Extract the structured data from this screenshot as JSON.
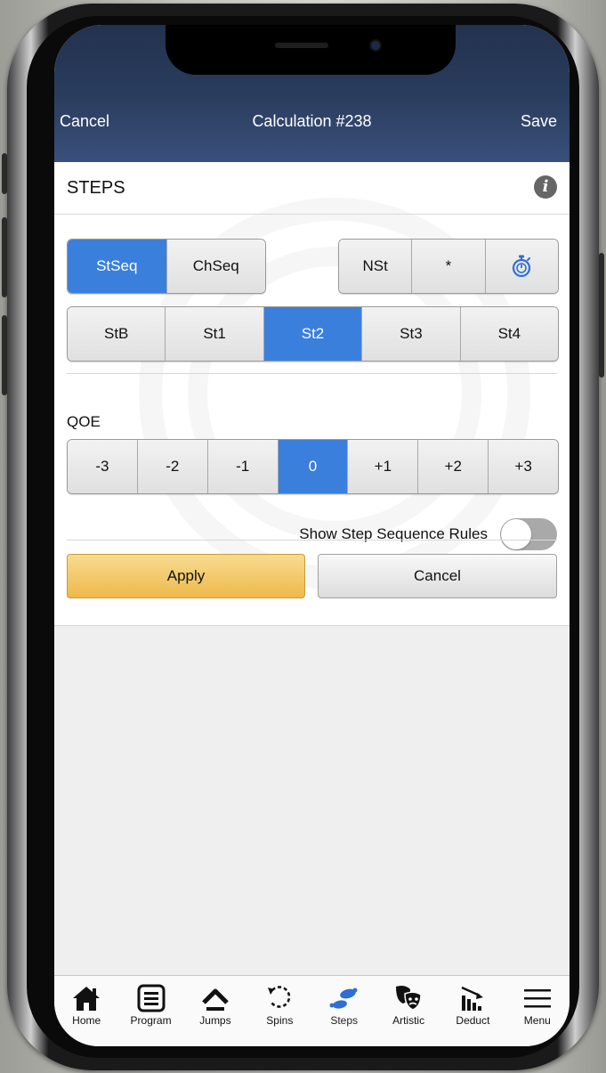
{
  "navbar": {
    "cancel_label": "Cancel",
    "title": "Calculation #238",
    "save_label": "Save"
  },
  "panel": {
    "title": "STEPS",
    "sequence_types": [
      {
        "label": "StSeq",
        "selected": true
      },
      {
        "label": "ChSeq",
        "selected": false
      }
    ],
    "modifiers": [
      {
        "label": "NSt"
      },
      {
        "label": "*"
      },
      {
        "icon": "stopwatch-icon"
      }
    ],
    "levels": [
      {
        "label": "StB",
        "selected": false
      },
      {
        "label": "St1",
        "selected": false
      },
      {
        "label": "St2",
        "selected": true
      },
      {
        "label": "St3",
        "selected": false
      },
      {
        "label": "St4",
        "selected": false
      }
    ],
    "qoe_label": "QOE",
    "qoe": [
      {
        "label": "-3",
        "selected": false
      },
      {
        "label": "-2",
        "selected": false
      },
      {
        "label": "-1",
        "selected": false
      },
      {
        "label": "0",
        "selected": true
      },
      {
        "label": "+1",
        "selected": false
      },
      {
        "label": "+2",
        "selected": false
      },
      {
        "label": "+3",
        "selected": false
      }
    ],
    "rules_toggle_label": "Show Step Sequence Rules",
    "rules_toggle_on": false,
    "apply_label": "Apply",
    "cancel_label": "Cancel"
  },
  "tabs": [
    {
      "label": "Home",
      "icon": "home-icon"
    },
    {
      "label": "Program",
      "icon": "list-icon"
    },
    {
      "label": "Jumps",
      "icon": "jump-icon"
    },
    {
      "label": "Spins",
      "icon": "spin-icon"
    },
    {
      "label": "Steps",
      "icon": "footsteps-icon",
      "active": true
    },
    {
      "label": "Artistic",
      "icon": "masks-icon"
    },
    {
      "label": "Deduct",
      "icon": "deduct-chart-icon"
    },
    {
      "label": "Menu",
      "icon": "hamburger-menu-icon"
    }
  ],
  "colors": {
    "accent": "#3b7fdc",
    "apply": "#eeb94a",
    "navbar": "#2a3c5d"
  }
}
